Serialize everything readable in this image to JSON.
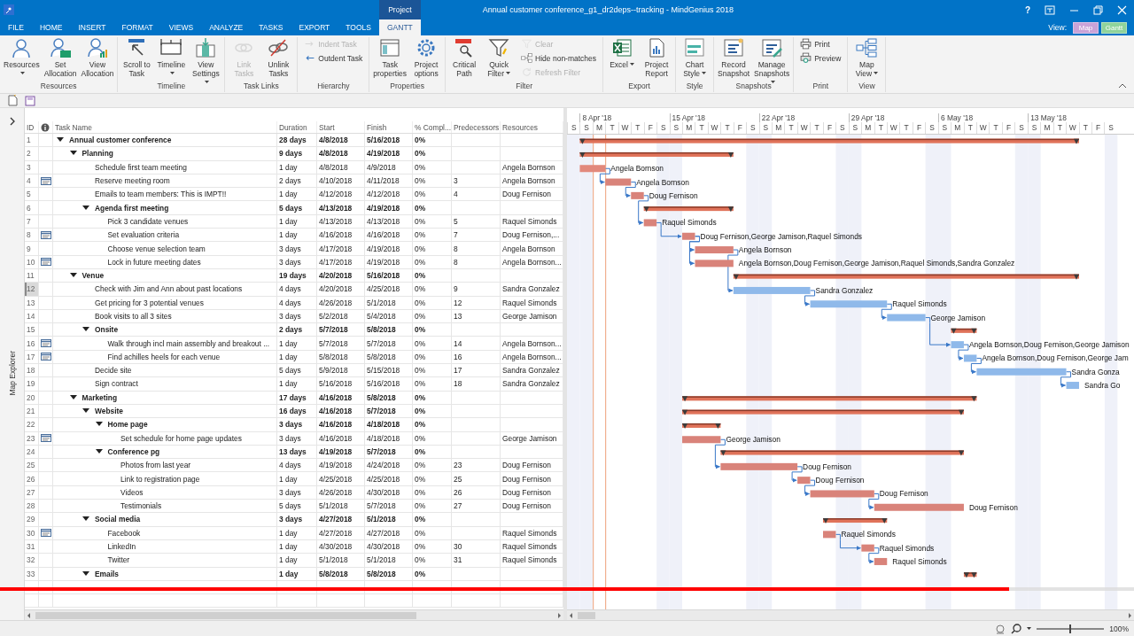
{
  "titlebar": {
    "title": "Annual customer conference_g1_dr2deps--tracking - MindGenius 2018",
    "help": "?",
    "tabs": [
      {
        "label": "FILE",
        "selected": false
      },
      {
        "label": "HOME",
        "selected": false
      },
      {
        "label": "INSERT",
        "selected": false
      },
      {
        "label": "FORMAT",
        "selected": false
      },
      {
        "label": "VIEWS",
        "selected": false
      },
      {
        "label": "ANALYZE",
        "selected": false
      },
      {
        "label": "TASKS",
        "selected": false
      },
      {
        "label": "EXPORT",
        "selected": false
      },
      {
        "label": "TOOLS",
        "selected": false
      },
      {
        "label": "GANTT",
        "selected": true,
        "context": "Project"
      }
    ],
    "view_label": "View:",
    "view_buttons": [
      {
        "label": "Map",
        "color": "#c9a3d8"
      },
      {
        "label": "Gantt",
        "color": "#8fd39b"
      }
    ]
  },
  "ribbon": {
    "groups": [
      {
        "label": "Resources",
        "buttons": [
          {
            "label": "Resources",
            "kind": "large",
            "dropdown": true,
            "disabled": false
          },
          {
            "label": "Set Allocation",
            "kind": "large",
            "dropdown": false,
            "disabled": false
          },
          {
            "label": "View Allocation",
            "kind": "large",
            "dropdown": false,
            "disabled": false
          }
        ]
      },
      {
        "label": "Timeline",
        "buttons": [
          {
            "label": "Scroll to Task",
            "kind": "large",
            "dropdown": false,
            "disabled": false
          },
          {
            "label": "Timeline",
            "kind": "large",
            "dropdown": true,
            "disabled": false
          },
          {
            "label": "View Settings",
            "kind": "large",
            "dropdown": true,
            "disabled": false
          }
        ]
      },
      {
        "label": "Task Links",
        "buttons": [
          {
            "label": "Link Tasks",
            "kind": "large",
            "dropdown": false,
            "disabled": true
          },
          {
            "label": "Unlink Tasks",
            "kind": "large",
            "dropdown": false,
            "disabled": false
          }
        ]
      },
      {
        "label": "Hierarchy",
        "buttons": [
          {
            "label": "Indent Task",
            "kind": "small",
            "disabled": true
          },
          {
            "label": "Outdent Task",
            "kind": "small",
            "disabled": false
          }
        ]
      },
      {
        "label": "Properties",
        "buttons": [
          {
            "label": "Task properties",
            "kind": "large",
            "dropdown": false,
            "disabled": false
          },
          {
            "label": "Project options",
            "kind": "large",
            "dropdown": false,
            "disabled": false
          }
        ]
      },
      {
        "label": "Filter",
        "buttons": [
          {
            "label": "Critical Path",
            "kind": "large",
            "dropdown": false,
            "disabled": false
          },
          {
            "label": "Quick Filter",
            "kind": "large",
            "dropdown": true,
            "disabled": false
          },
          {
            "label": "Clear",
            "kind": "small",
            "disabled": true
          },
          {
            "label": "Hide non-matches",
            "kind": "small",
            "disabled": false
          },
          {
            "label": "Refresh Filter",
            "kind": "small",
            "disabled": true
          }
        ]
      },
      {
        "label": "Export",
        "buttons": [
          {
            "label": "Excel",
            "kind": "large",
            "dropdown": true,
            "disabled": false
          },
          {
            "label": "Project Report",
            "kind": "large",
            "dropdown": false,
            "disabled": false
          }
        ]
      },
      {
        "label": "Style",
        "buttons": [
          {
            "label": "Chart Style",
            "kind": "large",
            "dropdown": true,
            "disabled": false
          }
        ]
      },
      {
        "label": "Snapshots",
        "buttons": [
          {
            "label": "Record Snapshot",
            "kind": "large",
            "dropdown": false,
            "disabled": false
          },
          {
            "label": "Manage Snapshots",
            "kind": "large",
            "dropdown": true,
            "disabled": false
          }
        ]
      },
      {
        "label": "Print",
        "buttons": [
          {
            "label": "Print",
            "kind": "small",
            "disabled": false
          },
          {
            "label": "Preview",
            "kind": "small",
            "disabled": false
          }
        ]
      },
      {
        "label": "View",
        "buttons": [
          {
            "label": "Map View",
            "kind": "large",
            "dropdown": true,
            "disabled": false
          }
        ]
      }
    ]
  },
  "sidebar": {
    "label": "Map Explorer"
  },
  "table": {
    "columns": [
      {
        "kind": "text",
        "label": "ID"
      },
      {
        "kind": "icon"
      },
      {
        "kind": "text",
        "label": "Task Name"
      },
      {
        "kind": "text",
        "label": "Duration"
      },
      {
        "kind": "text",
        "label": "Start"
      },
      {
        "kind": "text",
        "label": "Finish"
      },
      {
        "kind": "text",
        "label": "% Compl..."
      },
      {
        "kind": "text",
        "label": "Predecessors"
      },
      {
        "kind": "text",
        "label": "Resources"
      }
    ],
    "rows": [
      {
        "id": "1",
        "kind": "summary",
        "expanded": true,
        "selected": false,
        "note": false,
        "name": "Annual customer conference",
        "duration": "28 days",
        "start": "4/8/2018",
        "finish": "5/16/2018",
        "complete": "0%",
        "children": [
          {
            "id": "2",
            "kind": "summary",
            "expanded": true,
            "selected": false,
            "note": false,
            "name": "Planning",
            "duration": "9 days",
            "start": "4/8/2018",
            "finish": "4/19/2018",
            "complete": "0%",
            "children": [
              {
                "id": "3",
                "kind": "task",
                "selected": false,
                "note": false,
                "name": "Schedule first team meeting",
                "duration": "1 day",
                "start": "4/8/2018",
                "finish": "4/9/2018",
                "complete": "0%",
                "resources": "Angela Bornson",
                "color": "#e2897c",
                "bar_label": "Angela Bornson"
              },
              {
                "id": "4",
                "kind": "task",
                "selected": false,
                "note": true,
                "name": "Reserve meeting room",
                "duration": "2 days",
                "start": "4/10/2018",
                "finish": "4/11/2018",
                "complete": "0%",
                "predecessors": "3",
                "resources": "Angela Bornson",
                "color": "#d9837a",
                "bar_label": "Angela Bornson"
              },
              {
                "id": "5",
                "kind": "task",
                "selected": false,
                "note": false,
                "name": "Emails to team members: This is IMPT!!",
                "duration": "1 day",
                "start": "4/12/2018",
                "finish": "4/12/2018",
                "complete": "0%",
                "predecessors": "4",
                "resources": "Doug Fernison",
                "color": "#d9837a",
                "bar_label": "Doug Fernison"
              },
              {
                "id": "6",
                "kind": "summary",
                "expanded": true,
                "selected": false,
                "note": false,
                "name": "Agenda first meeting",
                "duration": "5 days",
                "start": "4/13/2018",
                "finish": "4/19/2018",
                "complete": "0%",
                "children": [
                  {
                    "id": "7",
                    "kind": "task",
                    "selected": false,
                    "note": false,
                    "name": "Pick 3 candidate venues",
                    "duration": "1 day",
                    "start": "4/13/2018",
                    "finish": "4/13/2018",
                    "complete": "0%",
                    "predecessors": "5",
                    "resources": "Raquel Simonds",
                    "color": "#d9837a",
                    "bar_label": "Raquel Simonds"
                  },
                  {
                    "id": "8",
                    "kind": "task",
                    "selected": false,
                    "note": true,
                    "name": "Set evaluation criteria",
                    "duration": "1 day",
                    "start": "4/16/2018",
                    "finish": "4/16/2018",
                    "complete": "0%",
                    "predecessors": "7",
                    "resources": "Doug Fernison,...",
                    "color": "#d9837a",
                    "bar_label": "Doug Fernison,George Jamison,Raquel Simonds"
                  },
                  {
                    "id": "9",
                    "kind": "task",
                    "selected": false,
                    "note": false,
                    "name": "Choose venue selection team",
                    "duration": "3 days",
                    "start": "4/17/2018",
                    "finish": "4/19/2018",
                    "complete": "0%",
                    "predecessors": "8",
                    "resources": "Angela Bornson",
                    "color": "#d9837a",
                    "bar_label": "Angela Bornson"
                  },
                  {
                    "id": "10",
                    "kind": "task",
                    "selected": false,
                    "note": true,
                    "name": "Lock in future meeting dates",
                    "duration": "3 days",
                    "start": "4/17/2018",
                    "finish": "4/19/2018",
                    "complete": "0%",
                    "predecessors": "8",
                    "resources": "Angela Bornson...",
                    "color": "#d9837a",
                    "bar_label": "Angela Bornson,Doug Fernison,George Jamison,Raquel Simonds,Sandra Gonzalez"
                  }
                ]
              }
            ]
          },
          {
            "id": "11",
            "kind": "summary",
            "expanded": true,
            "selected": false,
            "note": false,
            "name": "Venue",
            "duration": "19 days",
            "start": "4/20/2018",
            "finish": "5/16/2018",
            "complete": "0%",
            "children": [
              {
                "id": "12",
                "kind": "task",
                "selected": true,
                "note": false,
                "name": "Check with Jim and Ann about past locations",
                "duration": "4 days",
                "start": "4/20/2018",
                "finish": "4/25/2018",
                "complete": "0%",
                "predecessors": "9",
                "resources": "Sandra Gonzalez",
                "color": "#8fb9ea",
                "bar_label": "Sandra Gonzalez"
              },
              {
                "id": "13",
                "kind": "task",
                "selected": false,
                "note": false,
                "name": "Get pricing for 3 potential venues",
                "duration": "4 days",
                "start": "4/26/2018",
                "finish": "5/1/2018",
                "complete": "0%",
                "predecessors": "12",
                "resources": "Raquel Simonds",
                "color": "#8fb9ea",
                "bar_label": "Raquel Simonds"
              },
              {
                "id": "14",
                "kind": "task",
                "selected": false,
                "note": false,
                "name": "Book visits to all 3 sites",
                "duration": "3 days",
                "start": "5/2/2018",
                "finish": "5/4/2018",
                "complete": "0%",
                "predecessors": "13",
                "resources": "George Jamison",
                "color": "#8fb9ea",
                "bar_label": "George Jamison"
              },
              {
                "id": "15",
                "kind": "summary",
                "expanded": true,
                "selected": false,
                "note": false,
                "name": "Onsite",
                "duration": "2 days",
                "start": "5/7/2018",
                "finish": "5/8/2018",
                "complete": "0%",
                "children": [
                  {
                    "id": "16",
                    "kind": "task",
                    "selected": false,
                    "note": true,
                    "name": "Walk through incl main assembly and breakout ...",
                    "duration": "1 day",
                    "start": "5/7/2018",
                    "finish": "5/7/2018",
                    "complete": "0%",
                    "predecessors": "14",
                    "resources": "Angela Bornson...",
                    "color": "#8fb9ea",
                    "bar_label": "Angela Bornson,Doug Fernison,George Jamison"
                  },
                  {
                    "id": "17",
                    "kind": "task",
                    "selected": false,
                    "note": true,
                    "name": "Find achilles heels for each venue",
                    "duration": "1 day",
                    "start": "5/8/2018",
                    "finish": "5/8/2018",
                    "complete": "0%",
                    "predecessors": "16",
                    "resources": "Angela Bornson...",
                    "color": "#8fb9ea",
                    "bar_label": "Angela Bornson,Doug Fernison,George Jam"
                  }
                ]
              },
              {
                "id": "18",
                "kind": "task",
                "selected": false,
                "note": false,
                "name": "Decide site",
                "duration": "5 days",
                "start": "5/9/2018",
                "finish": "5/15/2018",
                "complete": "0%",
                "predecessors": "17",
                "resources": "Sandra Gonzalez",
                "color": "#8fb9ea",
                "bar_label": "Sandra Gonza"
              },
              {
                "id": "19",
                "kind": "task",
                "selected": false,
                "note": false,
                "name": "Sign contract",
                "duration": "1 day",
                "start": "5/16/2018",
                "finish": "5/16/2018",
                "complete": "0%",
                "predecessors": "18",
                "resources": "Sandra Gonzalez",
                "color": "#8fb9ea",
                "bar_label": "Sandra Go"
              }
            ]
          },
          {
            "id": "20",
            "kind": "summary",
            "expanded": true,
            "selected": false,
            "note": false,
            "name": "Marketing",
            "duration": "17 days",
            "start": "4/16/2018",
            "finish": "5/8/2018",
            "complete": "0%",
            "children": [
              {
                "id": "21",
                "kind": "summary",
                "expanded": true,
                "selected": false,
                "note": false,
                "name": "Website",
                "duration": "16 days",
                "start": "4/16/2018",
                "finish": "5/7/2018",
                "complete": "0%",
                "children": [
                  {
                    "id": "22",
                    "kind": "summary",
                    "expanded": true,
                    "selected": false,
                    "note": false,
                    "name": "Home page",
                    "duration": "3 days",
                    "start": "4/16/2018",
                    "finish": "4/18/2018",
                    "complete": "0%",
                    "children": [
                      {
                        "id": "23",
                        "kind": "task",
                        "selected": false,
                        "note": true,
                        "name": "Set schedule for home page updates",
                        "duration": "3 days",
                        "start": "4/16/2018",
                        "finish": "4/18/2018",
                        "complete": "0%",
                        "resources": "George Jamison",
                        "color": "#d9837a",
                        "bar_label": "George Jamison"
                      }
                    ]
                  },
                  {
                    "id": "24",
                    "kind": "summary",
                    "expanded": true,
                    "selected": false,
                    "note": false,
                    "name": "Conference pg",
                    "duration": "13 days",
                    "start": "4/19/2018",
                    "finish": "5/7/2018",
                    "complete": "0%",
                    "children": [
                      {
                        "id": "25",
                        "kind": "task",
                        "selected": false,
                        "note": false,
                        "name": "Photos from last year",
                        "duration": "4 days",
                        "start": "4/19/2018",
                        "finish": "4/24/2018",
                        "complete": "0%",
                        "predecessors": "23",
                        "resources": "Doug Fernison",
                        "color": "#d9837a",
                        "bar_label": "Doug Fernison"
                      },
                      {
                        "id": "26",
                        "kind": "task",
                        "selected": false,
                        "note": false,
                        "name": "Link to registration page",
                        "duration": "1 day",
                        "start": "4/25/2018",
                        "finish": "4/25/2018",
                        "complete": "0%",
                        "predecessors": "25",
                        "resources": "Doug Fernison",
                        "color": "#d9837a",
                        "bar_label": "Doug Fernison"
                      },
                      {
                        "id": "27",
                        "kind": "task",
                        "selected": false,
                        "note": false,
                        "name": "Videos",
                        "duration": "3 days",
                        "start": "4/26/2018",
                        "finish": "4/30/2018",
                        "complete": "0%",
                        "predecessors": "26",
                        "resources": "Doug Fernison",
                        "color": "#d9837a",
                        "bar_label": "Doug Fernison"
                      },
                      {
                        "id": "28",
                        "kind": "task",
                        "selected": false,
                        "note": false,
                        "name": "Testimonials",
                        "duration": "5 days",
                        "start": "5/1/2018",
                        "finish": "5/7/2018",
                        "complete": "0%",
                        "predecessors": "27",
                        "resources": "Doug Fernison",
                        "color": "#d9837a",
                        "bar_label": "Doug Fernison"
                      }
                    ]
                  }
                ]
              },
              {
                "id": "29",
                "kind": "summary",
                "expanded": true,
                "selected": false,
                "note": false,
                "name": "Social media",
                "duration": "3 days",
                "start": "4/27/2018",
                "finish": "5/1/2018",
                "complete": "0%",
                "children": [
                  {
                    "id": "30",
                    "kind": "task",
                    "selected": false,
                    "note": true,
                    "name": "Facebook",
                    "duration": "1 day",
                    "start": "4/27/2018",
                    "finish": "4/27/2018",
                    "complete": "0%",
                    "resources": "Raquel Simonds",
                    "color": "#d9837a",
                    "bar_label": "Raquel Simonds"
                  },
                  {
                    "id": "31",
                    "kind": "task",
                    "selected": false,
                    "note": false,
                    "name": "LinkedIn",
                    "duration": "1 day",
                    "start": "4/30/2018",
                    "finish": "4/30/2018",
                    "complete": "0%",
                    "predecessors": "30",
                    "resources": "Raquel Simonds",
                    "color": "#d9837a",
                    "bar_label": "Raquel Simonds"
                  },
                  {
                    "id": "32",
                    "kind": "task",
                    "selected": false,
                    "note": false,
                    "name": "Twitter",
                    "duration": "1 day",
                    "start": "5/1/2018",
                    "finish": "5/1/2018",
                    "complete": "0%",
                    "predecessors": "31",
                    "resources": "Raquel Simonds",
                    "color": "#d9837a",
                    "bar_label": "Raquel Simonds"
                  }
                ]
              },
              {
                "id": "33",
                "kind": "summary",
                "expanded": true,
                "selected": false,
                "note": false,
                "name": "Emails",
                "duration": "1 day",
                "start": "5/8/2018",
                "finish": "5/8/2018",
                "complete": "0%"
              }
            ]
          }
        ]
      }
    ]
  },
  "gantt": {
    "weeks": [
      "8 Apr '18",
      "15 Apr '18",
      "22 Apr '18",
      "29 Apr '18",
      "6 May '18",
      "13 May '18"
    ],
    "days": [
      "S",
      "S",
      "M",
      "T",
      "W",
      "T",
      "F",
      "S",
      "S",
      "M",
      "T",
      "W",
      "T",
      "F",
      "S",
      "S",
      "M",
      "T",
      "W",
      "T",
      "F",
      "S",
      "S",
      "M",
      "T",
      "W",
      "T",
      "F",
      "S",
      "S",
      "M",
      "T",
      "W",
      "T",
      "F",
      "S",
      "S",
      "M",
      "T",
      "W",
      "T",
      "F",
      "S"
    ]
  },
  "status_bar": {
    "zoom": "100%",
    "zoom_slider": {
      "level": 0.5
    }
  },
  "video_player": {
    "progress": {
      "level": 0.89
    }
  }
}
